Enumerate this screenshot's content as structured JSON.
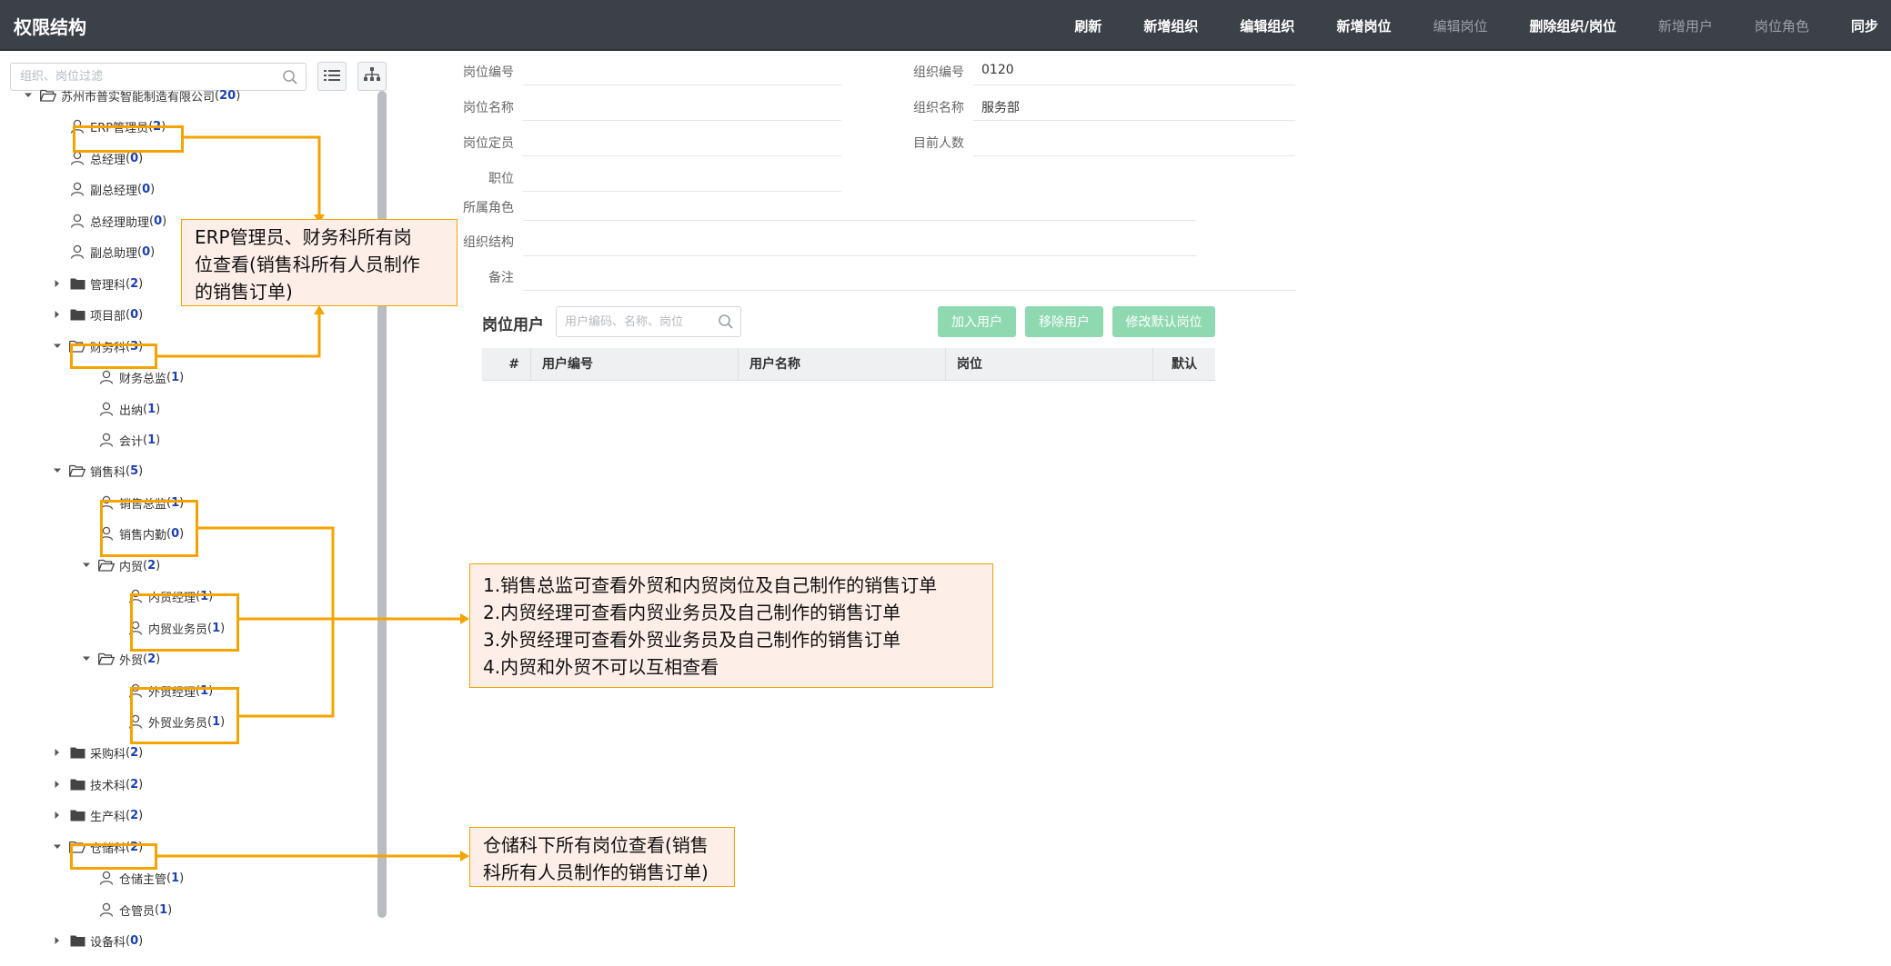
{
  "header": {
    "title": "权限结构",
    "actions": [
      {
        "label": "刷新",
        "enabled": true
      },
      {
        "label": "新增组织",
        "enabled": true
      },
      {
        "label": "编辑组织",
        "enabled": true
      },
      {
        "label": "新增岗位",
        "enabled": true
      },
      {
        "label": "编辑岗位",
        "enabled": false
      },
      {
        "label": "删除组织/岗位",
        "enabled": true
      },
      {
        "label": "新增用户",
        "enabled": false
      },
      {
        "label": "岗位角色",
        "enabled": false
      },
      {
        "label": "同步",
        "enabled": true
      }
    ]
  },
  "sidebar": {
    "filter_placeholder": "组织、岗位过滤",
    "tree": [
      {
        "label": "苏州市普实智能制造有限公司",
        "count": "20",
        "type": "folder-open",
        "level": 0,
        "expanded": true
      },
      {
        "label": "ERP管理员",
        "count": "2",
        "type": "user",
        "level": 1
      },
      {
        "label": "总经理",
        "count": "0",
        "type": "user",
        "level": 1
      },
      {
        "label": "副总经理",
        "count": "0",
        "type": "user",
        "level": 1
      },
      {
        "label": "总经理助理",
        "count": "0",
        "type": "user",
        "level": 1
      },
      {
        "label": "副总助理",
        "count": "0",
        "type": "user",
        "level": 1
      },
      {
        "label": "管理科",
        "count": "2",
        "type": "folder",
        "level": 1,
        "expanded": false
      },
      {
        "label": "项目部",
        "count": "0",
        "type": "folder",
        "level": 1,
        "expanded": false
      },
      {
        "label": "财务科",
        "count": "3",
        "type": "folder-open",
        "level": 1,
        "expanded": true
      },
      {
        "label": "财务总监",
        "count": "1",
        "type": "user",
        "level": 2
      },
      {
        "label": "出纳",
        "count": "1",
        "type": "user",
        "level": 2
      },
      {
        "label": "会计",
        "count": "1",
        "type": "user",
        "level": 2
      },
      {
        "label": "销售科",
        "count": "5",
        "type": "folder-open",
        "level": 1,
        "expanded": true
      },
      {
        "label": "销售总监",
        "count": "1",
        "type": "user",
        "level": 2
      },
      {
        "label": "销售内勤",
        "count": "0",
        "type": "user",
        "level": 2
      },
      {
        "label": "内贸",
        "count": "2",
        "type": "folder-open",
        "level": 2,
        "expanded": true
      },
      {
        "label": "内贸经理",
        "count": "1",
        "type": "user",
        "level": 3
      },
      {
        "label": "内贸业务员",
        "count": "1",
        "type": "user",
        "level": 3
      },
      {
        "label": "外贸",
        "count": "2",
        "type": "folder-open",
        "level": 2,
        "expanded": true
      },
      {
        "label": "外贸经理",
        "count": "1",
        "type": "user",
        "level": 3
      },
      {
        "label": "外贸业务员",
        "count": "1",
        "type": "user",
        "level": 3
      },
      {
        "label": "采购科",
        "count": "2",
        "type": "folder",
        "level": 1,
        "expanded": false
      },
      {
        "label": "技术科",
        "count": "2",
        "type": "folder",
        "level": 1,
        "expanded": false
      },
      {
        "label": "生产科",
        "count": "2",
        "type": "folder",
        "level": 1,
        "expanded": false
      },
      {
        "label": "仓储科",
        "count": "2",
        "type": "folder-open",
        "level": 1,
        "expanded": true
      },
      {
        "label": "仓储主管",
        "count": "1",
        "type": "user",
        "level": 2
      },
      {
        "label": "仓管员",
        "count": "1",
        "type": "user",
        "level": 2
      },
      {
        "label": "设备科",
        "count": "0",
        "type": "folder",
        "level": 1,
        "expanded": false
      }
    ]
  },
  "form": {
    "post_code_label": "岗位编号",
    "post_code": "",
    "org_code_label": "组织编号",
    "org_code": "0120",
    "post_name_label": "岗位名称",
    "post_name": "",
    "org_name_label": "组织名称",
    "org_name": "服务部",
    "post_quota_label": "岗位定员",
    "post_quota": "",
    "current_count_label": "目前人数",
    "current_count": "",
    "position_label": "职位",
    "position": "",
    "role_label": "所属角色",
    "role": "",
    "org_structure_label": "组织结构",
    "org_structure": "",
    "remark_label": "备注",
    "remark": ""
  },
  "post_users": {
    "title": "岗位用户",
    "search_placeholder": "用户编码、名称、岗位",
    "buttons": [
      "加入用户",
      "移除用户",
      "修改默认岗位"
    ],
    "columns": [
      "#",
      "用户编号",
      "用户名称",
      "岗位",
      "默认"
    ],
    "rows": []
  },
  "annotations": {
    "note1": [
      "ERP管理员、财务科所有岗",
      "位查看(销售科所有人员制作",
      "的销售订单)"
    ],
    "note2": [
      "1.销售总监可查看外贸和内贸岗位及自己制作的销售订单",
      "2.内贸经理可查看内贸业务员及自己制作的销售订单",
      "3.外贸经理可查看外贸业务员及自己制作的销售订单",
      "4.内贸和外贸不可以互相查看"
    ],
    "note3": [
      "仓储科下所有岗位查看(销售",
      "科所有人员制作的销售订单)"
    ]
  },
  "colors": {
    "accent": "#f5a300",
    "header_bg": "#3c4147",
    "count": "#1b3fb5",
    "button_green": "#8fd9b0",
    "note_bg": "#fdeee7"
  }
}
